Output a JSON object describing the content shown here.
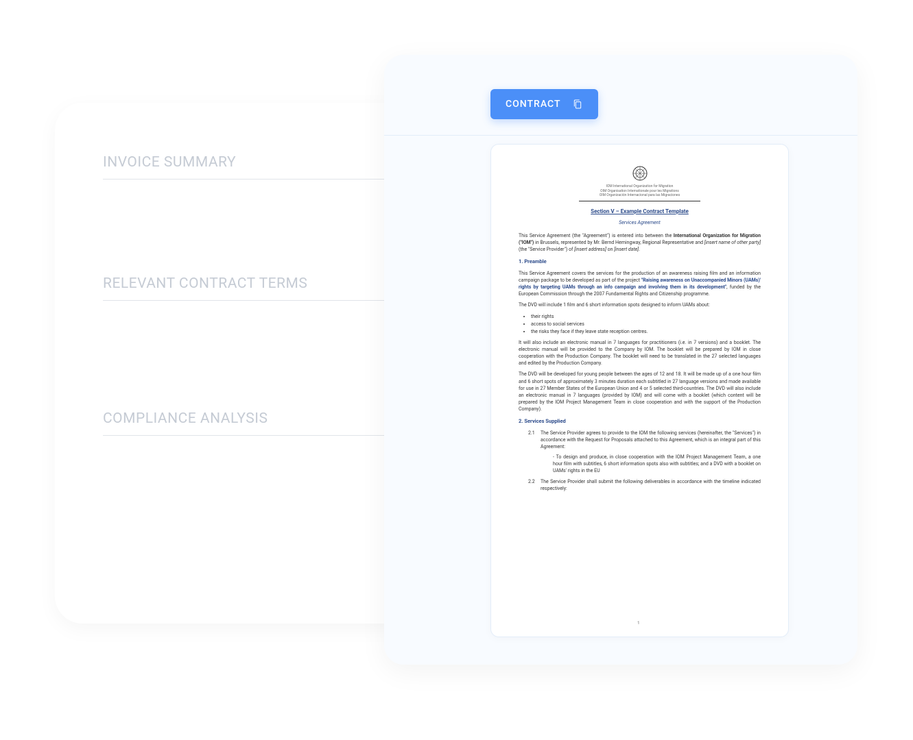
{
  "leftPanel": {
    "sections": [
      {
        "title": "INVOICE SUMMARY"
      },
      {
        "title": "RELEVANT CONTRACT TERMS"
      },
      {
        "title": "COMPLIANCE ANALYSIS"
      }
    ]
  },
  "contractTab": {
    "label": "CONTRACT"
  },
  "document": {
    "orgLines": [
      "IOM International Organization for Migration",
      "OIM Organisation Internationale pour les Migrations",
      "OIM Organización Internacional para las Migraciones"
    ],
    "sectionTitle": "Section V – Example Contract Template",
    "agreementType": "Services Agreement",
    "intro": {
      "pre": "This Service Agreement (the \"Agreement\") is entered into between the ",
      "org": "International Organization for Migration (\"IOM\")",
      "mid": " in Brussels, represented by Mr. Bernd Hemingway, Regional Representative and ",
      "party": "[insert name of other party]",
      "mid2": " (the \"Service Provider\") of ",
      "addr": "[insert address]",
      "mid3": " on ",
      "date": "[insert date]",
      "end": "."
    },
    "preamble": {
      "heading": "1.  Preamble",
      "p1pre": "This Service Agreement covers the services for the production of an awareness raising film and an information campaign package to be developed as part of the project ",
      "p1bold": "\"Raising awareness on Unaccompanied Minors (UAMs)' rights by targeting UAMs through an info campaign and involving them in its development\"",
      "p1post": ", funded by the European Commission through the 2007 Fundamental Rights and Citizenship programme.",
      "p2": "The DVD will include 1 film and 6 short information spots designed to inform UAMs about:",
      "list": [
        "their rights",
        "access to social services",
        "the risks they face if they leave state reception centres."
      ],
      "p3": "It will also include an electronic manual in 7 languages for practitioners (i.e. in 7 versions) and a booklet. The electronic manual will be provided to the Company by IOM.  The booklet will be prepared by IOM in close cooperation with the Production Company. The booklet will need to be translated in the 27 selected languages and edited by the Production Company.",
      "p4": "The DVD will be developed for young people between the ages of 12 and 18. It will be made up of a one hour film and 6 short spots of approximately 3 minutes duration each subtitled in 27 language versions and made available for use in 27 Member States of the European Union and 4 or 5 selected third-countries. The DVD will also include an electronic manual in 7 languages (provided by IOM) and will come with a booklet (which content will be prepared by the IOM Project Management Team in close cooperation and with the support of the Production Company)."
    },
    "services": {
      "heading": "2.  Services Supplied",
      "item21num": "2.1",
      "item21": "The Service Provider agrees to provide to the IOM the following services (hereinafter, the \"Services\") in accordance with the Request for Proposals attached to this Agreement, which is an integral part of this Agreement:",
      "item21sub": "- To design and produce, in close cooperation with the IOM Project Management Team, a one hour film with subtitles, 6 short information spots also with subtitles; and a DVD with a booklet on UAMs' rights in the EU",
      "item22num": "2.2",
      "item22": "The Service Provider shall submit the following deliverables in accordance with the timeline indicated respectively:"
    },
    "pageNumber": "1"
  }
}
